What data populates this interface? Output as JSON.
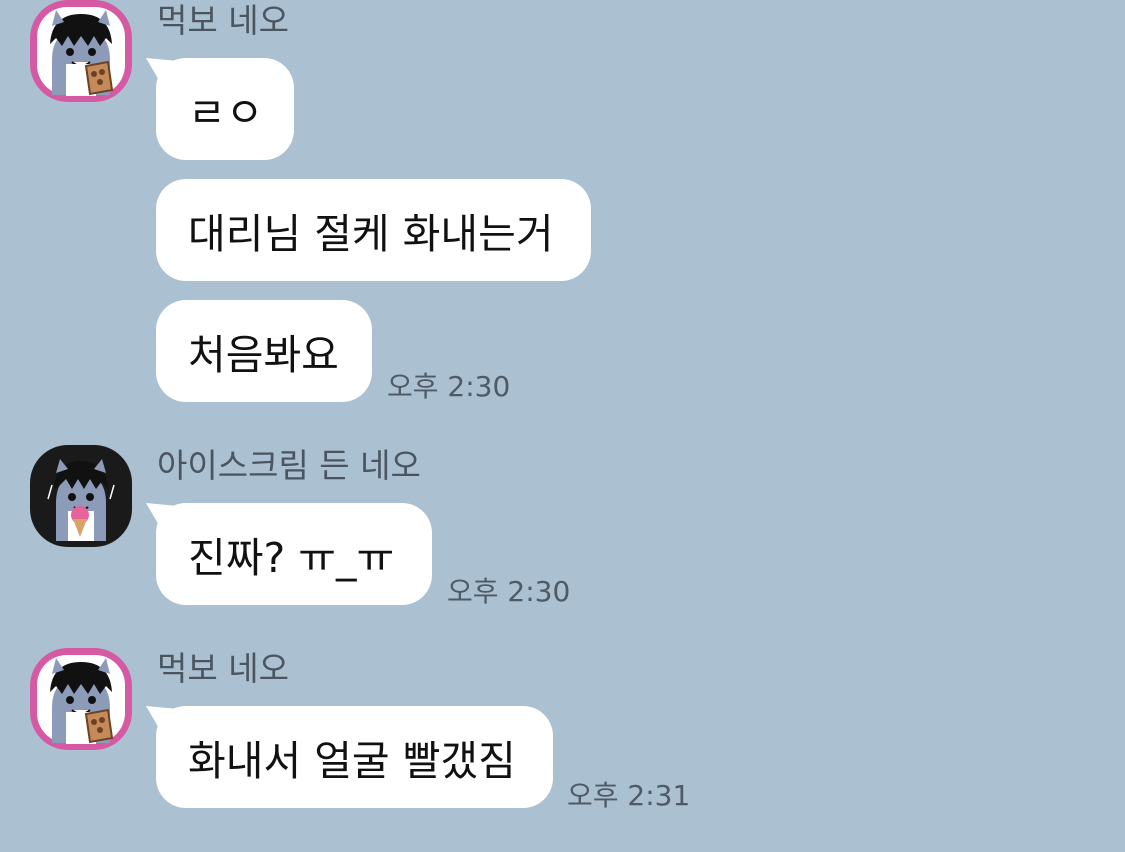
{
  "colors": {
    "background": "#abc1d1",
    "bubble": "#ffffff",
    "avatar_pink": "#d65aa3",
    "avatar_black": "#1a1a1a"
  },
  "messages": [
    {
      "sender": "먹보 네오",
      "avatar_icon": "neo-eating-avatar-icon",
      "bubbles": [
        "ㄹㅇ",
        "대리님 절케 화내는거",
        "처음봐요"
      ],
      "time": "오후 2:30"
    },
    {
      "sender": "아이스크림 든 네오",
      "avatar_icon": "neo-icecream-avatar-icon",
      "bubbles": [
        "진짜? ㅠ_ㅠ"
      ],
      "time": "오후 2:30"
    },
    {
      "sender": "먹보 네오",
      "avatar_icon": "neo-eating-avatar-icon",
      "bubbles": [
        "화내서 얼굴 빨갰짐"
      ],
      "time": "오후 2:31"
    }
  ]
}
